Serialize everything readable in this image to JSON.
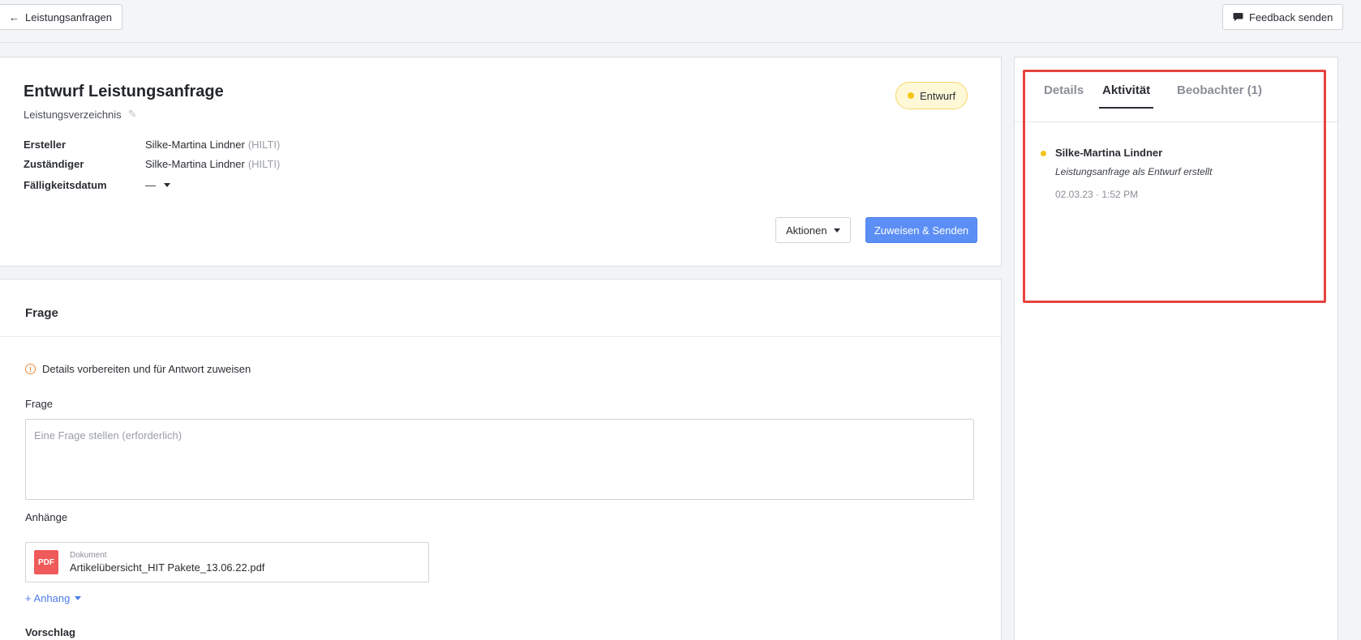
{
  "topbar": {
    "back_label": "Leistungsanfragen",
    "feedback_label": "Feedback senden"
  },
  "request": {
    "title": "Entwurf Leistungsanfrage",
    "subtitle": "Leistungsverzeichnis",
    "status": "Entwurf",
    "creator_label": "Ersteller",
    "creator_name": "Silke-Martina Lindner",
    "creator_company": "(HILTI)",
    "assignee_label": "Zuständiger",
    "assignee_name": "Silke-Martina Lindner",
    "assignee_company": "(HILTI)",
    "due_label": "Fälligkeitsdatum",
    "due_value": "—",
    "actions_label": "Aktionen",
    "send_label": "Zuweisen & Senden"
  },
  "question": {
    "section_title": "Frage",
    "info_text": "Details vorbereiten und für Antwort zuweisen",
    "field_label": "Frage",
    "placeholder": "Eine Frage stellen (erforderlich)",
    "attachments_label": "Anhänge",
    "attachment_type": "Dokument",
    "attachment_icon_text": "PDF",
    "attachment_name": "Artikelübersicht_HIT Pakete_13.06.22.pdf",
    "add_attachment_label": "+ Anhang",
    "suggestion_label": "Vorschlag"
  },
  "sidebar": {
    "tabs": [
      "Details",
      "Aktivität",
      "Beobachter (1)"
    ],
    "active_tab": "Aktivität",
    "activity": {
      "user": "Silke-Martina Lindner",
      "text": "Leistungsanfrage als Entwurf erstellt",
      "time": "02.03.23 · 1:52 PM"
    }
  },
  "colors": {
    "primary": "#5c8ff5",
    "status_dot": "#f5c518",
    "highlight": "#e8433f",
    "pdf": "#ef5a5a"
  }
}
